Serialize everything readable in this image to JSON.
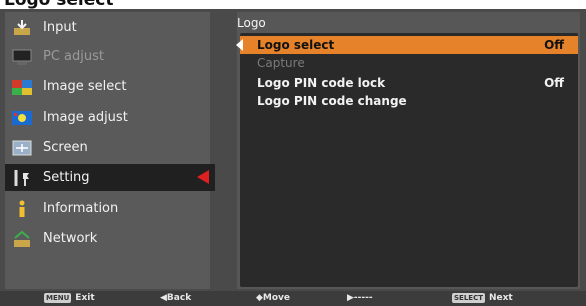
{
  "page_heading": "Logo select",
  "sidebar": {
    "items": [
      {
        "label": "Input",
        "icon": "input-icon",
        "dim": false
      },
      {
        "label": "PC adjust",
        "icon": "pc-adjust-icon",
        "dim": true
      },
      {
        "label": "Image select",
        "icon": "image-select-icon",
        "dim": false
      },
      {
        "label": "Image adjust",
        "icon": "image-adjust-icon",
        "dim": false
      },
      {
        "label": "Screen",
        "icon": "screen-icon",
        "dim": false
      },
      {
        "label": "Setting",
        "icon": "setting-icon",
        "dim": false,
        "active": true
      },
      {
        "label": "Information",
        "icon": "information-icon",
        "dim": false
      },
      {
        "label": "Network",
        "icon": "network-icon",
        "dim": false
      }
    ]
  },
  "panel": {
    "title": "Logo",
    "rows": [
      {
        "label": "Logo select",
        "value": "Off",
        "selected": true
      },
      {
        "label": "Capture",
        "value": "",
        "disabled": true
      },
      {
        "label": "Logo PIN code lock",
        "value": "Off"
      },
      {
        "label": "Logo PIN code change",
        "value": ""
      }
    ]
  },
  "footer": {
    "exit_key": "MENU",
    "exit": "Exit",
    "back": "◀Back",
    "move": "◆Move",
    "next_placeholder": "▶-----",
    "next_key": "SELECT",
    "next": "Next"
  },
  "colors": {
    "selection": "#e5822a",
    "active_arrow": "#e02020"
  }
}
